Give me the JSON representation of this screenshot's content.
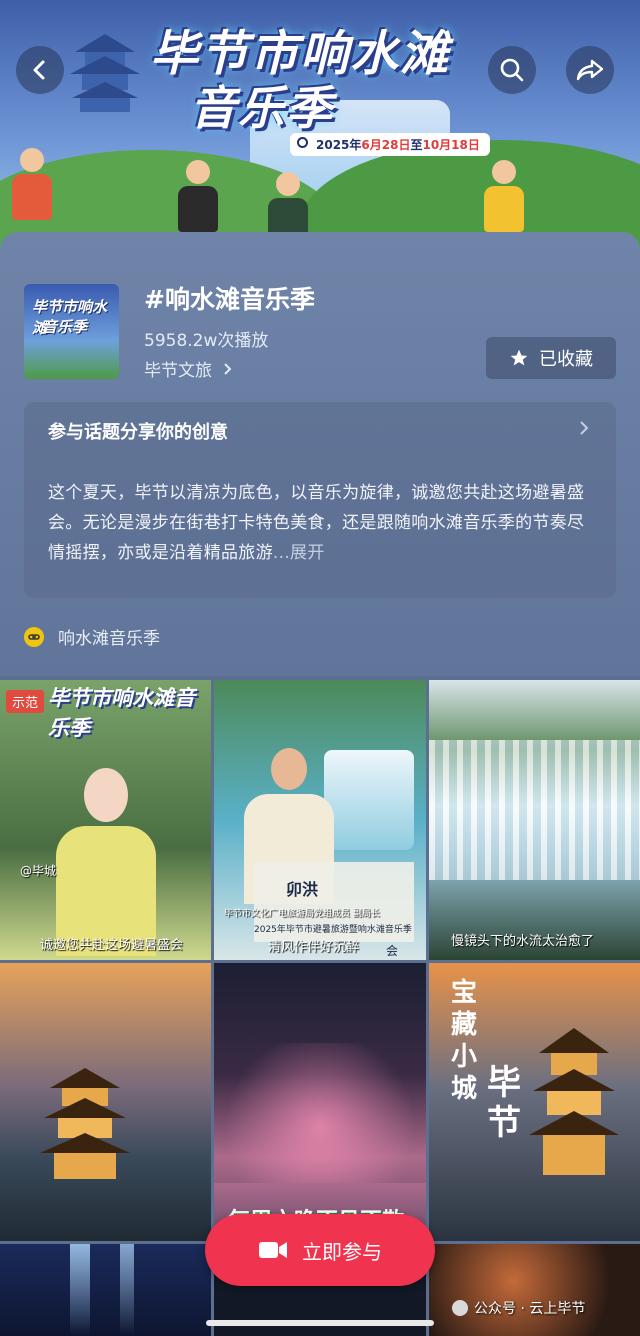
{
  "banner": {
    "title_line1": "毕节市响水滩",
    "title_line2": "音乐季",
    "dates_prefix": "2025年",
    "dates_start": "6月28日",
    "dates_mid": "至",
    "dates_end": "10月18日"
  },
  "nav": {
    "back_icon": "chevron-left-icon",
    "search_icon": "search-icon",
    "share_icon": "share-icon"
  },
  "topic": {
    "thumb_line1": "毕节市响水滩",
    "thumb_line2": "音乐季",
    "title": "#响水滩音乐季",
    "plays": "5958.2w次播放",
    "author": "毕节文旅",
    "fav_label": "已收藏"
  },
  "card": {
    "heading": "参与话题分享你的创意",
    "body": "这个夏天，毕节以清凉为底色，以音乐为旋律，诚邀您共赴这场避暑盛会。无论是漫步在街巷打卡特色美食，还是跟随响水滩音乐季的节奏尽情摇摆，亦或是沿着精品旅游",
    "ellipsis": "...",
    "more": "展开"
  },
  "link": {
    "label": "响水滩音乐季"
  },
  "grid": {
    "tile1": {
      "badge": "示范",
      "overlay_title": "毕节市响水滩音乐季",
      "handle": "@毕城",
      "caption": "诚邀您共赴这场避暑盛会"
    },
    "tile2": {
      "name": "卯洪",
      "role": "毕节市文化广电旅游局党组成员 副局长",
      "event": "2025年毕节市避暑旅游暨响水滩音乐季",
      "caption": "清风作伴好沉醉",
      "tail": "会"
    },
    "tile3": {
      "caption": "慢镜头下的水流太治愈了"
    },
    "tile4": {},
    "tile5": {
      "caption": "每周六晚不见不散"
    },
    "tile6": {
      "v1": "宝藏小城",
      "v2": "毕节"
    }
  },
  "cta": {
    "label": "立即参与"
  },
  "watermark": {
    "text": "公众号 · 云上毕节"
  },
  "colors": {
    "accent": "#f0344f",
    "badge": "#e04a3f",
    "link_icon": "#f1c40f"
  }
}
